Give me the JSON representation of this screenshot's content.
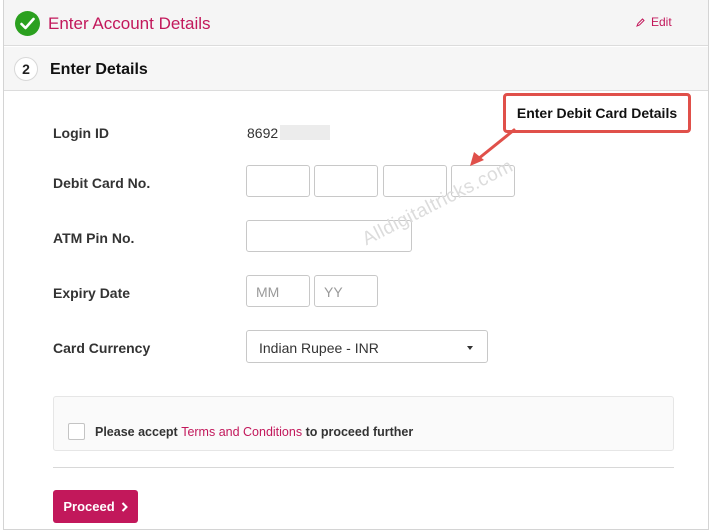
{
  "step1": {
    "title": "Enter Account Details",
    "edit_label": "Edit"
  },
  "step2": {
    "number": "2",
    "title": "Enter Details"
  },
  "form": {
    "login_id": {
      "label": "Login ID",
      "value": "8692"
    },
    "debit_card": {
      "label": "Debit Card No."
    },
    "atm_pin": {
      "label": "ATM Pin No."
    },
    "expiry": {
      "label": "Expiry Date",
      "mm_placeholder": "MM",
      "yy_placeholder": "YY"
    },
    "currency": {
      "label": "Card Currency",
      "selected": "Indian Rupee - INR"
    }
  },
  "terms": {
    "prefix": "Please accept",
    "link": "Terms and Conditions",
    "suffix": "to proceed further"
  },
  "proceed_label": "Proceed",
  "callout": "Enter Debit Card Details",
  "watermark": "Alldigitaltricks.com",
  "colors": {
    "accent": "#c2185b",
    "success": "#2ba01f",
    "callout_border": "#e0504a"
  }
}
